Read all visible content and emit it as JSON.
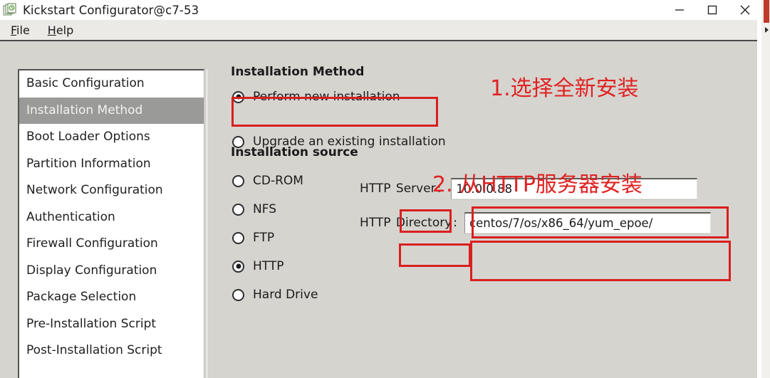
{
  "window": {
    "title": "Kickstart Configurator@c7-53",
    "app_icon": "stacked-documents-icon",
    "controls": {
      "minimize": "minimize-icon",
      "maximize": "maximize-icon",
      "close": "close-icon"
    }
  },
  "menubar": {
    "items": [
      {
        "mnemonic": "F",
        "rest": "ile"
      },
      {
        "mnemonic": "H",
        "rest": "elp"
      }
    ]
  },
  "sidebar": {
    "items": [
      {
        "label": "Basic Configuration",
        "selected": false
      },
      {
        "label": "Installation Method",
        "selected": true
      },
      {
        "label": "Boot Loader Options",
        "selected": false
      },
      {
        "label": "Partition Information",
        "selected": false
      },
      {
        "label": "Network Configuration",
        "selected": false
      },
      {
        "label": "Authentication",
        "selected": false
      },
      {
        "label": "Firewall Configuration",
        "selected": false
      },
      {
        "label": "Display Configuration",
        "selected": false
      },
      {
        "label": "Package Selection",
        "selected": false
      },
      {
        "label": "Pre-Installation Script",
        "selected": false
      },
      {
        "label": "Post-Installation Script",
        "selected": false
      }
    ]
  },
  "main": {
    "installation_method": {
      "heading": "Installation Method",
      "options": [
        {
          "label": "Perform new installation",
          "selected": true
        },
        {
          "label": "Upgrade an existing installation",
          "selected": false
        }
      ]
    },
    "installation_source": {
      "heading": "Installation source",
      "options": [
        {
          "label": "CD-ROM",
          "selected": false
        },
        {
          "label": "NFS",
          "selected": false
        },
        {
          "label": "FTP",
          "selected": false
        },
        {
          "label": "HTTP",
          "selected": true
        },
        {
          "label": "Hard Drive",
          "selected": false
        }
      ]
    },
    "fields": {
      "server": {
        "label_prefix": "HTTP ",
        "label_boxed": "Server",
        "label_suffix": ":",
        "value": "10.0.0.88"
      },
      "directory": {
        "label_prefix": "HTTP ",
        "label_boxed": "Directory",
        "label_suffix": ":",
        "value": "centos/7/os/x86_64/yum_epoe/"
      }
    }
  },
  "annotations": {
    "color": "#e02222",
    "note_1": "1.选择全新安装",
    "note_2": "2. 从HTTP服务器安装"
  }
}
